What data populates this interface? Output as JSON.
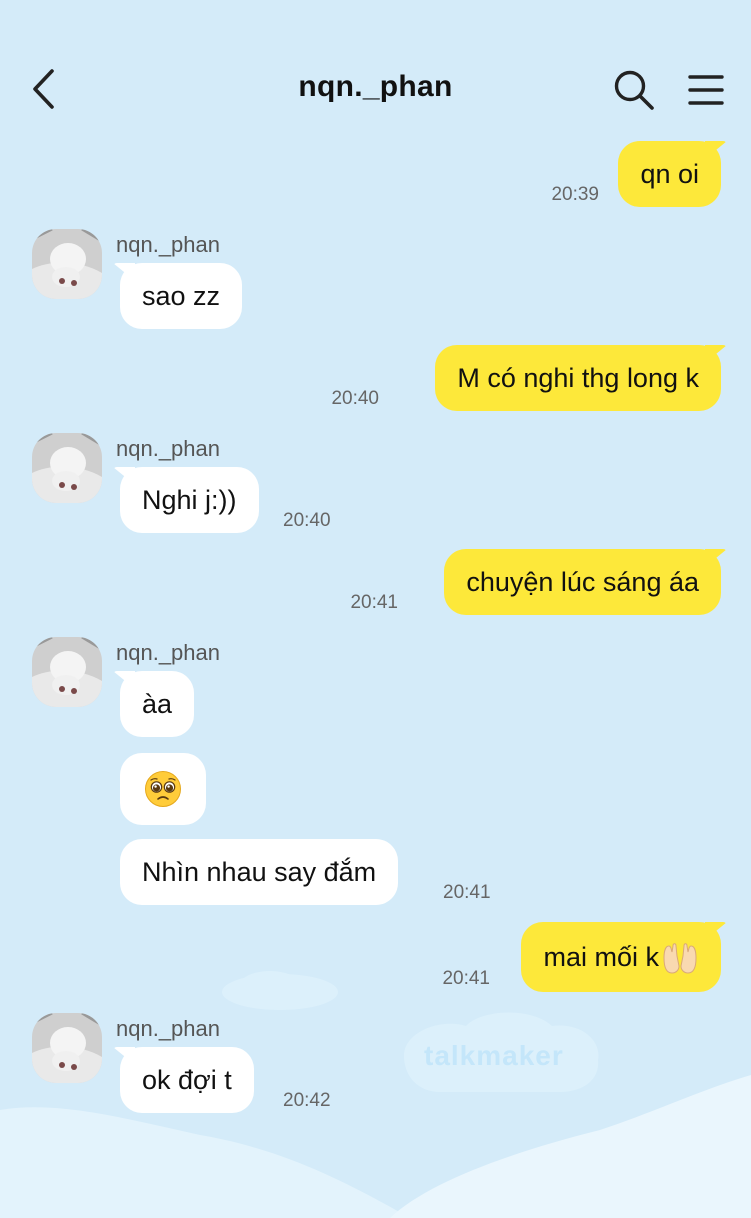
{
  "header": {
    "title": "nqn._phan",
    "back_icon": "chevron-left-icon",
    "search_icon": "search-icon",
    "menu_icon": "hamburger-menu-icon"
  },
  "colors": {
    "background": "#d4ebf9",
    "outgoing_bubble": "#fde83a",
    "incoming_bubble": "#ffffff"
  },
  "watermark": "talkmaker",
  "messages": [
    {
      "dir": "out",
      "text": "qn oi",
      "time": "20:39"
    },
    {
      "dir": "in",
      "sender": "nqn._phan",
      "text": "sao zz"
    },
    {
      "dir": "out",
      "text": "M có nghi thg long k",
      "time": "20:40"
    },
    {
      "dir": "in",
      "sender": "nqn._phan",
      "text": "Nghi j:))",
      "time": "20:40"
    },
    {
      "dir": "out",
      "text": "chuyện lúc sáng áa",
      "time": "20:41"
    },
    {
      "dir": "in",
      "sender": "nqn._phan",
      "text": "àa"
    },
    {
      "dir": "in",
      "emoji": "pleading-face-icon"
    },
    {
      "dir": "in",
      "text": "Nhìn nhau say đắm",
      "time": "20:41"
    },
    {
      "dir": "out",
      "text": "mai mối k",
      "emoji": "palms-up-icon",
      "time": "20:41"
    },
    {
      "dir": "in",
      "sender": "nqn._phan",
      "text": "ok đợi t",
      "time": "20:42"
    }
  ]
}
